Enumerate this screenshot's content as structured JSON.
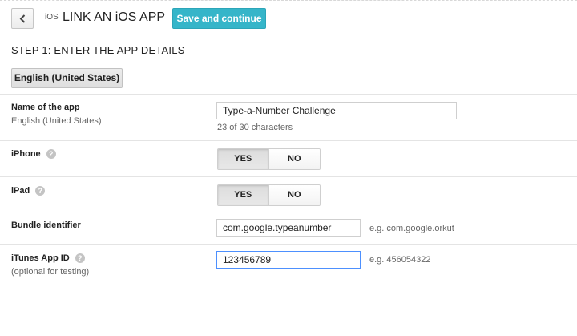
{
  "header": {
    "ios_mark": "iOS",
    "title": "LINK AN iOS APP",
    "save_label": "Save and continue"
  },
  "step": {
    "title": "STEP 1: ENTER THE APP DETAILS",
    "language_button": "English (United States)"
  },
  "fields": {
    "app_name": {
      "label": "Name of the app",
      "sublabel": "English (United States)",
      "value": "Type-a-Number Challenge",
      "char_count": "23 of 30 characters"
    },
    "iphone": {
      "label": "iPhone",
      "yes": "YES",
      "no": "NO",
      "selected": "YES"
    },
    "ipad": {
      "label": "iPad",
      "yes": "YES",
      "no": "NO",
      "selected": "YES"
    },
    "bundle": {
      "label": "Bundle identifier",
      "value": "com.google.typeanumber",
      "example": "e.g. com.google.orkut"
    },
    "itunes": {
      "label": "iTunes App ID",
      "sublabel": "(optional for testing)",
      "value": "123456789",
      "example": "e.g. 456054322"
    }
  },
  "icons": {
    "back": "chevron-left-icon",
    "help": "help-icon"
  },
  "colors": {
    "primary_button": "#35b5c9",
    "focus_border": "#4d90fe"
  }
}
